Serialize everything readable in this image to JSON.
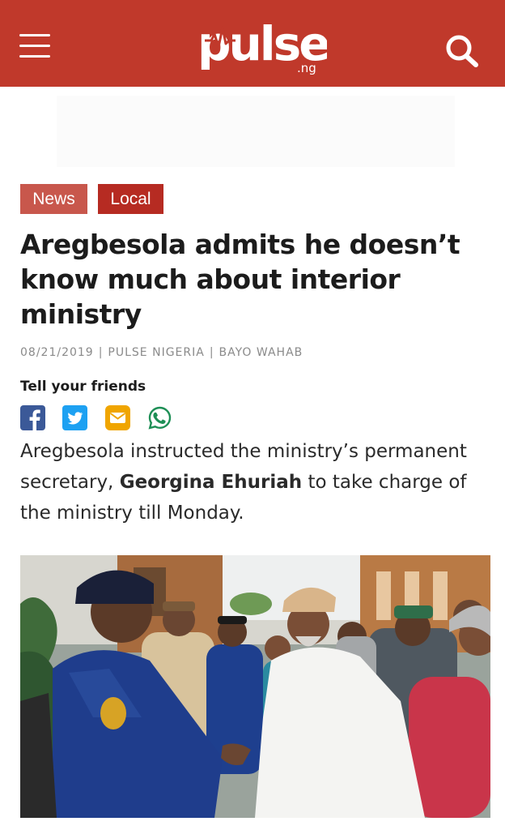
{
  "header": {
    "logo_text": "pulse",
    "logo_suffix": ".ng",
    "icons": {
      "menu": "hamburger-menu-icon",
      "search": "search-icon"
    },
    "background_color": "#c0392b"
  },
  "tags": [
    {
      "label": "News",
      "color": "#c8574c"
    },
    {
      "label": "Local",
      "color": "#b62b22"
    }
  ],
  "article": {
    "title": "Aregbesola admits he doesn’t know much about interior ministry",
    "date": "08/21/2019",
    "source": "PULSE NIGERIA",
    "author": "BAYO WAHAB",
    "share_label": "Tell your friends",
    "share_icons": [
      {
        "name": "facebook-icon",
        "color": "#3b5998"
      },
      {
        "name": "twitter-icon",
        "color": "#1da1f2"
      },
      {
        "name": "email-icon",
        "color": "#f0a500"
      },
      {
        "name": "whatsapp-icon",
        "color": "#1e8f56"
      }
    ],
    "summary_before": "Aregbesola instructed the ministry’s permanent secretary, ",
    "summary_bold": "Georgina Ehuriah",
    "summary_after": " to take charge of the ministry till Monday."
  }
}
